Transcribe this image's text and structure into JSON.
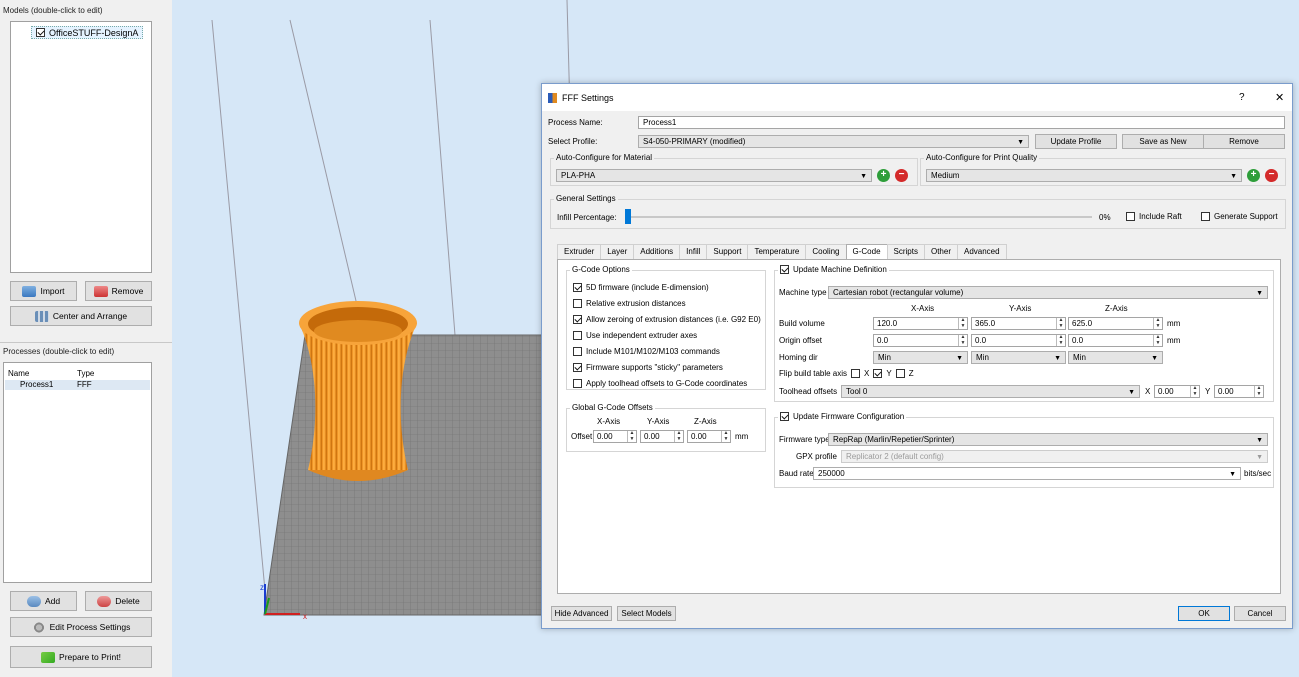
{
  "left_panel": {
    "models_title": "Models (double-click to edit)",
    "models": [
      {
        "name": "OfficeSTUFF-DesignA",
        "checked": true
      }
    ],
    "import_label": "Import",
    "remove_label": "Remove",
    "center_label": "Center and Arrange",
    "processes_title": "Processes (double-click to edit)",
    "col_name": "Name",
    "col_type": "Type",
    "process_row": {
      "name": "Process1",
      "type": "FFF"
    },
    "add_label": "Add",
    "delete_label": "Delete",
    "edit_label": "Edit Process Settings",
    "prepare_label": "Prepare to Print!"
  },
  "dialog": {
    "title": "FFF Settings",
    "help": "?",
    "close": "✕",
    "process_name_label": "Process Name:",
    "process_name": "Process1",
    "select_profile_label": "Select Profile:",
    "profile": "S4-050-PRIMARY (modified)",
    "update_profile": "Update Profile",
    "save_as_new": "Save as New",
    "remove": "Remove",
    "material_group": "Auto-Configure for Material",
    "material": "PLA-PHA",
    "quality_group": "Auto-Configure for Print Quality",
    "quality": "Medium",
    "general_group": "General Settings",
    "infill_label": "Infill Percentage:",
    "infill_value": "0%",
    "infill_fraction": 0,
    "include_raft": "Include Raft",
    "generate_support": "Generate Support",
    "tabs": [
      "Extruder",
      "Layer",
      "Additions",
      "Infill",
      "Support",
      "Temperature",
      "Cooling",
      "G-Code",
      "Scripts",
      "Other",
      "Advanced"
    ],
    "active_tab": "G-Code",
    "gcode_options_title": "G-Code Options",
    "gcode_options": [
      {
        "label": "5D firmware (include E-dimension)",
        "checked": true
      },
      {
        "label": "Relative extrusion distances",
        "checked": false
      },
      {
        "label": "Allow zeroing of extrusion distances (i.e. G92 E0)",
        "checked": true
      },
      {
        "label": "Use independent extruder axes",
        "checked": false
      },
      {
        "label": "Include M101/M102/M103 commands",
        "checked": false
      },
      {
        "label": "Firmware supports \"sticky\" parameters",
        "checked": true
      },
      {
        "label": "Apply toolhead offsets to G-Code coordinates",
        "checked": false
      }
    ],
    "offsets_title": "Global G-Code Offsets",
    "offset_x_hdr": "X-Axis",
    "offset_y_hdr": "Y-Axis",
    "offset_z_hdr": "Z-Axis",
    "offset_label": "Offset",
    "offset_x": "0.00",
    "offset_y": "0.00",
    "offset_z": "0.00",
    "mm": "mm",
    "update_machine": "Update Machine Definition",
    "machine_type_label": "Machine type",
    "machine_type": "Cartesian robot (rectangular volume)",
    "x_axis": "X-Axis",
    "y_axis": "Y-Axis",
    "z_axis": "Z-Axis",
    "build_volume_label": "Build volume",
    "build_x": "120.0",
    "build_y": "365.0",
    "build_z": "625.0",
    "origin_label": "Origin offset",
    "origin_x": "0.0",
    "origin_y": "0.0",
    "origin_z": "0.0",
    "homing_label": "Homing dir",
    "homing_x": "Min",
    "homing_y": "Min",
    "homing_z": "Min",
    "flip_label": "Flip build table axis",
    "flip_x": "X",
    "flip_y": "Y",
    "flip_z": "Z",
    "toolhead_label": "Toolhead offsets",
    "toolhead": "Tool 0",
    "toolhead_x_label": "X",
    "toolhead_x": "0.00",
    "toolhead_y_label": "Y",
    "toolhead_y": "0.00",
    "update_firmware": "Update Firmware Configuration",
    "firmware_type_label": "Firmware type",
    "firmware_type": "RepRap (Marlin/Repetier/Sprinter)",
    "gpx_label": "GPX profile",
    "gpx_profile": "Replicator 2 (default config)",
    "baud_label": "Baud rate",
    "baud": "250000",
    "bits": "bits/sec",
    "hide_advanced": "Hide Advanced",
    "select_models": "Select Models",
    "ok": "OK",
    "cancel": "Cancel"
  },
  "colors": {
    "accent": "#0078d7",
    "model": "#f5a623",
    "bed": "#8c8c8c",
    "viewport": "#d6e7f7"
  }
}
